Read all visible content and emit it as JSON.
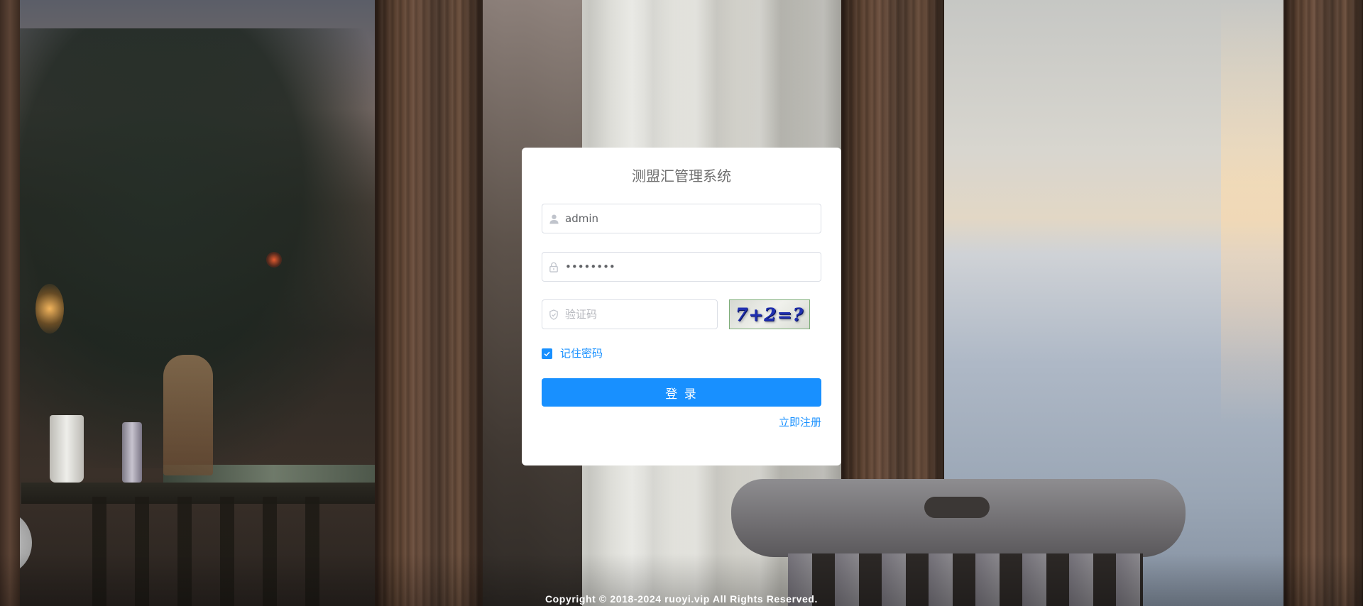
{
  "app": {
    "title": "测盟汇管理系统"
  },
  "form": {
    "username": {
      "value": "admin",
      "icon": "user-icon"
    },
    "password": {
      "value": "********",
      "icon": "lock-icon"
    },
    "code": {
      "value": "",
      "placeholder": "验证码",
      "icon": "shield-check-icon"
    },
    "captcha_text": "7+2=?",
    "remember": {
      "label": "记住密码",
      "checked": true
    },
    "login_label": "登 录",
    "register_label": "立即注册"
  },
  "footer": {
    "copyright": "Copyright © 2018-2024 ruoyi.vip All Rights Reserved."
  },
  "colors": {
    "primary": "#1890ff",
    "card": "#ffffff",
    "title": "#707070",
    "border": "#dcdfe6"
  }
}
